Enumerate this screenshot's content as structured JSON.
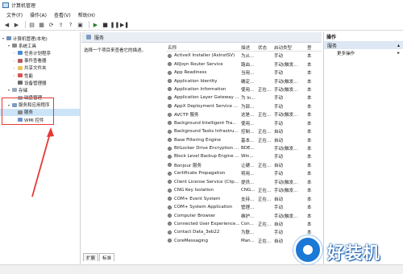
{
  "window": {
    "title": "计算机管理"
  },
  "menu": [
    "文件(F)",
    "操作(A)",
    "查看(V)",
    "帮助(H)"
  ],
  "tree": [
    {
      "label": "计算机管理(本地)",
      "level": 0,
      "expander": "▾",
      "icon": "ic-comp",
      "name": "tree-root"
    },
    {
      "label": "系统工具",
      "level": 1,
      "expander": "▾",
      "icon": "ic-tool",
      "name": "tree-system-tools"
    },
    {
      "label": "任务计划程序",
      "level": 2,
      "expander": "›",
      "icon": "ic-clock",
      "name": "tree-task-scheduler"
    },
    {
      "label": "事件查看器",
      "level": 2,
      "expander": "›",
      "icon": "ic-log",
      "name": "tree-event-viewer"
    },
    {
      "label": "共享文件夹",
      "level": 2,
      "expander": "›",
      "icon": "ic-folder",
      "name": "tree-shared-folders"
    },
    {
      "label": "性能",
      "level": 2,
      "expander": "›",
      "icon": "ic-perf",
      "name": "tree-performance"
    },
    {
      "label": "设备管理器",
      "level": 2,
      "expander": "",
      "icon": "ic-dev",
      "name": "tree-device-manager"
    },
    {
      "label": "存储",
      "level": 1,
      "expander": "▾",
      "icon": "ic-disk",
      "name": "tree-storage"
    },
    {
      "label": "磁盘管理",
      "level": 2,
      "expander": "",
      "icon": "ic-disk",
      "name": "tree-disk-management"
    },
    {
      "label": "服务和应用程序",
      "level": 1,
      "expander": "▾",
      "icon": "ic-svc",
      "name": "tree-services-apps"
    },
    {
      "label": "服务",
      "level": 2,
      "expander": "",
      "icon": "ic-gear",
      "name": "tree-services",
      "selected": true
    },
    {
      "label": "WMI 控件",
      "level": 2,
      "expander": "",
      "icon": "ic-wmi",
      "name": "tree-wmi-control"
    }
  ],
  "header": {
    "title": "服务"
  },
  "description_hint": "选择一个项目来查看它的描述。",
  "table": {
    "columns": [
      "名称",
      "描述",
      "状态",
      "启动类型",
      "登"
    ],
    "rows": [
      [
        "ActiveX Installer (AxInstSV)",
        "为从...",
        "",
        "手动",
        "本"
      ],
      [
        "AllJoyn Router Service",
        "路由...",
        "",
        "手动(触发...",
        "本"
      ],
      [
        "App Readiness",
        "当用...",
        "",
        "手动",
        "本"
      ],
      [
        "Application Identity",
        "确定...",
        "",
        "手动(触发...",
        "本"
      ],
      [
        "Application Information",
        "使用...",
        "正在...",
        "手动(触发...",
        "本"
      ],
      [
        "Application Layer Gateway ...",
        "为 In...",
        "",
        "手动",
        "本"
      ],
      [
        "AppX Deployment Service ...",
        "为部...",
        "",
        "手动",
        "本"
      ],
      [
        "AVCTP 服务",
        "这是...",
        "正在...",
        "手动(触发...",
        "本"
      ],
      [
        "Background Intelligent Tra...",
        "使用...",
        "",
        "手动",
        "本"
      ],
      [
        "Background Tasks Infrastru...",
        "控制...",
        "正在...",
        "自动",
        "本"
      ],
      [
        "Base Filtering Engine",
        "基本...",
        "正在...",
        "自动",
        "本"
      ],
      [
        "BitLocker Drive Encryption ...",
        "BDE...",
        "",
        "手动(触发...",
        "本"
      ],
      [
        "Block Level Backup Engine ...",
        "Win...",
        "",
        "手动",
        "本"
      ],
      [
        "Bonjour 服务",
        "让硬...",
        "正在...",
        "自动",
        "本"
      ],
      [
        "Certificate Propagation",
        "将用...",
        "",
        "手动",
        "本"
      ],
      [
        "Client License Service (Clip...",
        "提供...",
        "",
        "手动(触发...",
        "本"
      ],
      [
        "CNG Key Isolation",
        "CNG...",
        "正在...",
        "手动(触发...",
        "本"
      ],
      [
        "COM+ Event System",
        "支持...",
        "正在...",
        "自动",
        "本"
      ],
      [
        "COM+ System Application",
        "管理...",
        "",
        "手动",
        "本"
      ],
      [
        "Computer Browser",
        "维护...",
        "",
        "手动(触发...",
        "本"
      ],
      [
        "Connected User Experience...",
        "Con...",
        "正在...",
        "自动",
        "本"
      ],
      [
        "Contact Data_3eb22",
        "为联...",
        "",
        "手动",
        "本"
      ],
      [
        "CoreMessaging",
        "Man...",
        "正在...",
        "自动",
        "本"
      ]
    ]
  },
  "actions": {
    "header": "操作",
    "section": "服务",
    "more": "更多操作"
  },
  "tabs": [
    "扩展",
    "标准"
  ],
  "watermark": "好装机"
}
